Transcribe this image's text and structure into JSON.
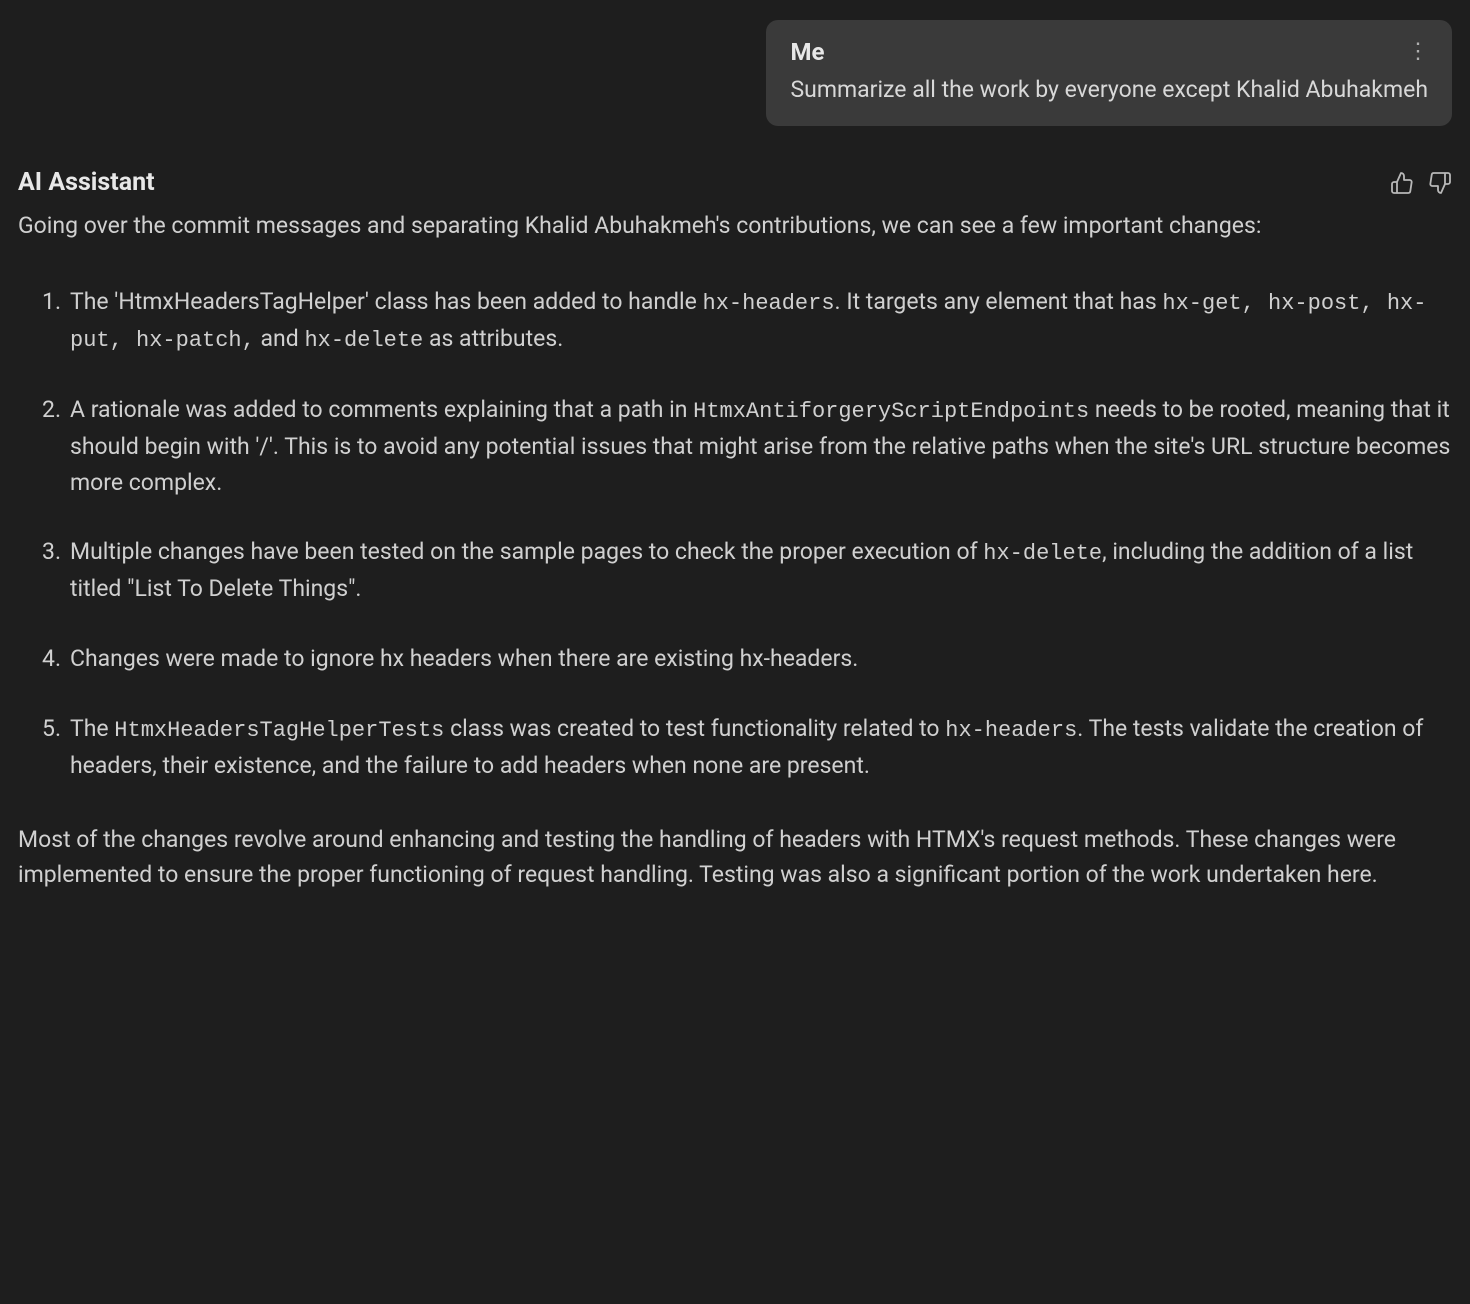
{
  "user": {
    "label": "Me",
    "message": "Summarize all the work by everyone except Khalid Abuhakmeh"
  },
  "assistant": {
    "label": "AI Assistant",
    "intro": "Going over the commit messages and separating Khalid Abuhakmeh's contributions, we can see a few important changes:",
    "items": [
      {
        "t1": "The 'HtmxHeadersTagHelper' class has been added to handle ",
        "c1": "hx-headers",
        "t2": ". It targets any element that has ",
        "c2": "hx-get, hx-post, hx-put, hx-patch,",
        "t3": " and ",
        "c3": "hx-delete",
        "t4": " as attributes."
      },
      {
        "t1": "A rationale was added to comments explaining that a path in ",
        "c1": "HtmxAntiforgeryScriptEndpoints",
        "t2": " needs to be rooted, meaning that it should begin with '/'. This is to avoid any potential issues that might arise from the relative paths when the site's URL structure becomes more complex."
      },
      {
        "t1": "Multiple changes have been tested on the sample pages to check the proper execution of ",
        "c1": "hx-delete",
        "t2": ", including the addition of a list titled \"List To Delete Things\"."
      },
      {
        "t1": "Changes were made to ignore hx headers when there are existing hx-headers."
      },
      {
        "t1": "The ",
        "c1": "HtmxHeadersTagHelperTests",
        "t2": " class was created to test functionality related to ",
        "c2": "hx-headers",
        "t3": ". The tests validate the creation of headers, their existence, and the failure to add headers when none are present."
      }
    ],
    "conclusion": "Most of the changes revolve around enhancing and testing the handling of headers with HTMX's request methods. These changes were implemented to ensure the proper functioning of request handling. Testing was also a significant portion of the work undertaken here."
  }
}
